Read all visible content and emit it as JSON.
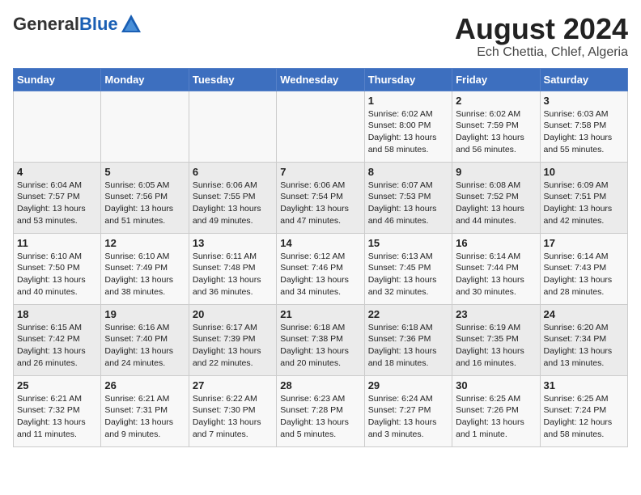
{
  "header": {
    "logo_general": "General",
    "logo_blue": "Blue",
    "title": "August 2024",
    "subtitle": "Ech Chettia, Chlef, Algeria"
  },
  "weekdays": [
    "Sunday",
    "Monday",
    "Tuesday",
    "Wednesday",
    "Thursday",
    "Friday",
    "Saturday"
  ],
  "weeks": [
    [
      {
        "day": "",
        "info": ""
      },
      {
        "day": "",
        "info": ""
      },
      {
        "day": "",
        "info": ""
      },
      {
        "day": "",
        "info": ""
      },
      {
        "day": "1",
        "info": "Sunrise: 6:02 AM\nSunset: 8:00 PM\nDaylight: 13 hours\nand 58 minutes."
      },
      {
        "day": "2",
        "info": "Sunrise: 6:02 AM\nSunset: 7:59 PM\nDaylight: 13 hours\nand 56 minutes."
      },
      {
        "day": "3",
        "info": "Sunrise: 6:03 AM\nSunset: 7:58 PM\nDaylight: 13 hours\nand 55 minutes."
      }
    ],
    [
      {
        "day": "4",
        "info": "Sunrise: 6:04 AM\nSunset: 7:57 PM\nDaylight: 13 hours\nand 53 minutes."
      },
      {
        "day": "5",
        "info": "Sunrise: 6:05 AM\nSunset: 7:56 PM\nDaylight: 13 hours\nand 51 minutes."
      },
      {
        "day": "6",
        "info": "Sunrise: 6:06 AM\nSunset: 7:55 PM\nDaylight: 13 hours\nand 49 minutes."
      },
      {
        "day": "7",
        "info": "Sunrise: 6:06 AM\nSunset: 7:54 PM\nDaylight: 13 hours\nand 47 minutes."
      },
      {
        "day": "8",
        "info": "Sunrise: 6:07 AM\nSunset: 7:53 PM\nDaylight: 13 hours\nand 46 minutes."
      },
      {
        "day": "9",
        "info": "Sunrise: 6:08 AM\nSunset: 7:52 PM\nDaylight: 13 hours\nand 44 minutes."
      },
      {
        "day": "10",
        "info": "Sunrise: 6:09 AM\nSunset: 7:51 PM\nDaylight: 13 hours\nand 42 minutes."
      }
    ],
    [
      {
        "day": "11",
        "info": "Sunrise: 6:10 AM\nSunset: 7:50 PM\nDaylight: 13 hours\nand 40 minutes."
      },
      {
        "day": "12",
        "info": "Sunrise: 6:10 AM\nSunset: 7:49 PM\nDaylight: 13 hours\nand 38 minutes."
      },
      {
        "day": "13",
        "info": "Sunrise: 6:11 AM\nSunset: 7:48 PM\nDaylight: 13 hours\nand 36 minutes."
      },
      {
        "day": "14",
        "info": "Sunrise: 6:12 AM\nSunset: 7:46 PM\nDaylight: 13 hours\nand 34 minutes."
      },
      {
        "day": "15",
        "info": "Sunrise: 6:13 AM\nSunset: 7:45 PM\nDaylight: 13 hours\nand 32 minutes."
      },
      {
        "day": "16",
        "info": "Sunrise: 6:14 AM\nSunset: 7:44 PM\nDaylight: 13 hours\nand 30 minutes."
      },
      {
        "day": "17",
        "info": "Sunrise: 6:14 AM\nSunset: 7:43 PM\nDaylight: 13 hours\nand 28 minutes."
      }
    ],
    [
      {
        "day": "18",
        "info": "Sunrise: 6:15 AM\nSunset: 7:42 PM\nDaylight: 13 hours\nand 26 minutes."
      },
      {
        "day": "19",
        "info": "Sunrise: 6:16 AM\nSunset: 7:40 PM\nDaylight: 13 hours\nand 24 minutes."
      },
      {
        "day": "20",
        "info": "Sunrise: 6:17 AM\nSunset: 7:39 PM\nDaylight: 13 hours\nand 22 minutes."
      },
      {
        "day": "21",
        "info": "Sunrise: 6:18 AM\nSunset: 7:38 PM\nDaylight: 13 hours\nand 20 minutes."
      },
      {
        "day": "22",
        "info": "Sunrise: 6:18 AM\nSunset: 7:36 PM\nDaylight: 13 hours\nand 18 minutes."
      },
      {
        "day": "23",
        "info": "Sunrise: 6:19 AM\nSunset: 7:35 PM\nDaylight: 13 hours\nand 16 minutes."
      },
      {
        "day": "24",
        "info": "Sunrise: 6:20 AM\nSunset: 7:34 PM\nDaylight: 13 hours\nand 13 minutes."
      }
    ],
    [
      {
        "day": "25",
        "info": "Sunrise: 6:21 AM\nSunset: 7:32 PM\nDaylight: 13 hours\nand 11 minutes."
      },
      {
        "day": "26",
        "info": "Sunrise: 6:21 AM\nSunset: 7:31 PM\nDaylight: 13 hours\nand 9 minutes."
      },
      {
        "day": "27",
        "info": "Sunrise: 6:22 AM\nSunset: 7:30 PM\nDaylight: 13 hours\nand 7 minutes."
      },
      {
        "day": "28",
        "info": "Sunrise: 6:23 AM\nSunset: 7:28 PM\nDaylight: 13 hours\nand 5 minutes."
      },
      {
        "day": "29",
        "info": "Sunrise: 6:24 AM\nSunset: 7:27 PM\nDaylight: 13 hours\nand 3 minutes."
      },
      {
        "day": "30",
        "info": "Sunrise: 6:25 AM\nSunset: 7:26 PM\nDaylight: 13 hours\nand 1 minute."
      },
      {
        "day": "31",
        "info": "Sunrise: 6:25 AM\nSunset: 7:24 PM\nDaylight: 12 hours\nand 58 minutes."
      }
    ]
  ]
}
